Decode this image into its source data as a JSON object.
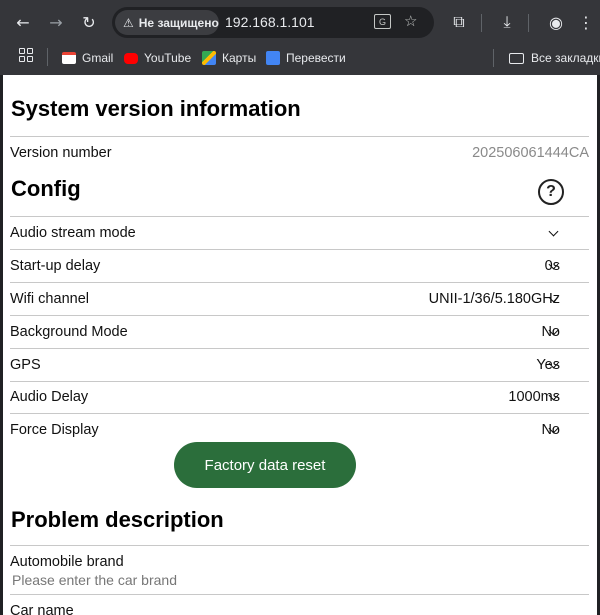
{
  "browser": {
    "security_label": "Не защищено",
    "url": "192.168.1.101",
    "bookmarks": [
      "Gmail",
      "YouTube",
      "Карты",
      "Перевести"
    ],
    "all_bookmarks": "Все закладки"
  },
  "system": {
    "title": "System version information",
    "version_label": "Version number",
    "version_value": "202506061444CA"
  },
  "config": {
    "title": "Config",
    "help_glyph": "?",
    "rows": [
      {
        "label": "Audio stream mode",
        "value": ""
      },
      {
        "label": "Start-up delay",
        "value": "0s"
      },
      {
        "label": "Wifi channel",
        "value": "UNII-1/36/5.180GHz"
      },
      {
        "label": "Background Mode",
        "value": "No"
      },
      {
        "label": "GPS",
        "value": "Yes"
      },
      {
        "label": "Audio Delay",
        "value": "1000ms"
      },
      {
        "label": "Force Display",
        "value": "No"
      }
    ],
    "reset_label": "Factory data reset"
  },
  "problem": {
    "title": "Problem description",
    "brand_label": "Automobile brand",
    "brand_placeholder": "Please enter the car brand",
    "car_name_label": "Car name"
  },
  "colors": {
    "reset_button": "#2b6e3b",
    "browser_chrome": "#35363a"
  }
}
